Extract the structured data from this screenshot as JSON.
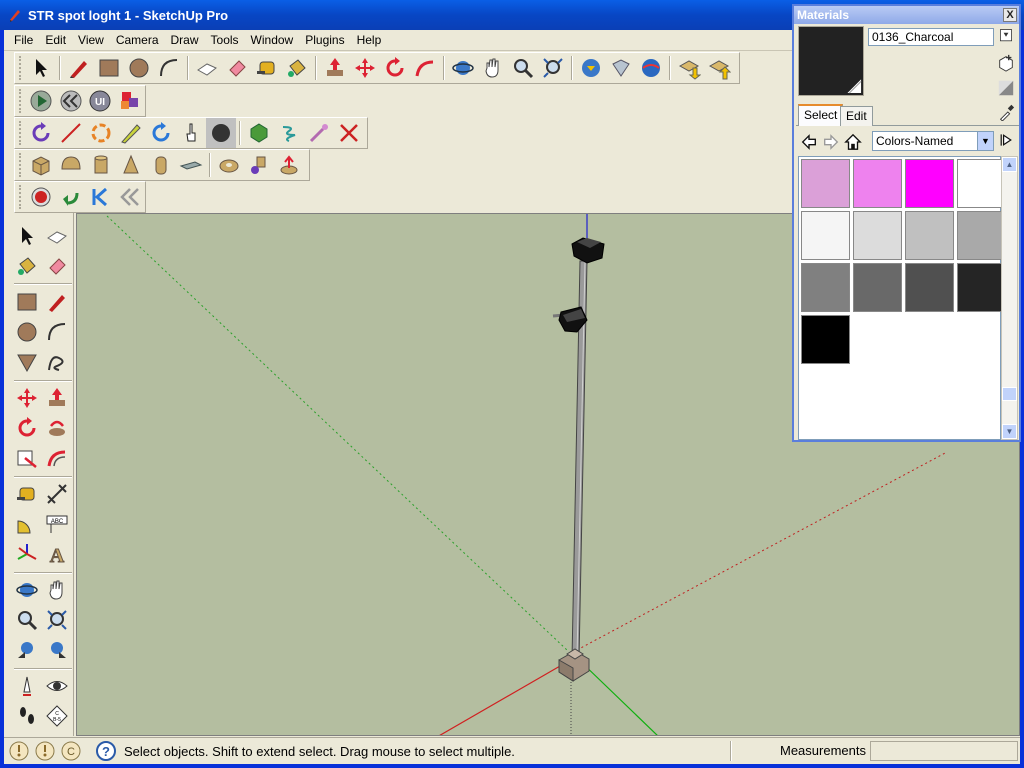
{
  "window": {
    "title": "STR spot loght 1 - SketchUp Pro"
  },
  "menu": [
    "File",
    "Edit",
    "View",
    "Camera",
    "Draw",
    "Tools",
    "Window",
    "Plugins",
    "Help"
  ],
  "status": {
    "message": "Select objects. Shift to extend select. Drag mouse to select multiple.",
    "measurements_label": "Measurements",
    "measurements_value": ""
  },
  "materials": {
    "title": "Materials",
    "close": "X",
    "current_name": "0136_Charcoal",
    "current_color": "#222222",
    "tab_select": "Select",
    "tab_edit": "Edit",
    "library": "Colors-Named",
    "swatches": [
      "#dba0d8",
      "#ee82ee",
      "#ff00ff",
      "#ffffff",
      "#f5f5f5",
      "#dcdcdc",
      "#c0c0c0",
      "#a9a9a9",
      "#808080",
      "#696969",
      "#505050",
      "#252525",
      "#000000"
    ]
  },
  "colors": {
    "viewport": "#b4bea0",
    "axis_red": "#cc2222",
    "axis_green": "#22aa22",
    "axis_blue": "#2222cc"
  }
}
